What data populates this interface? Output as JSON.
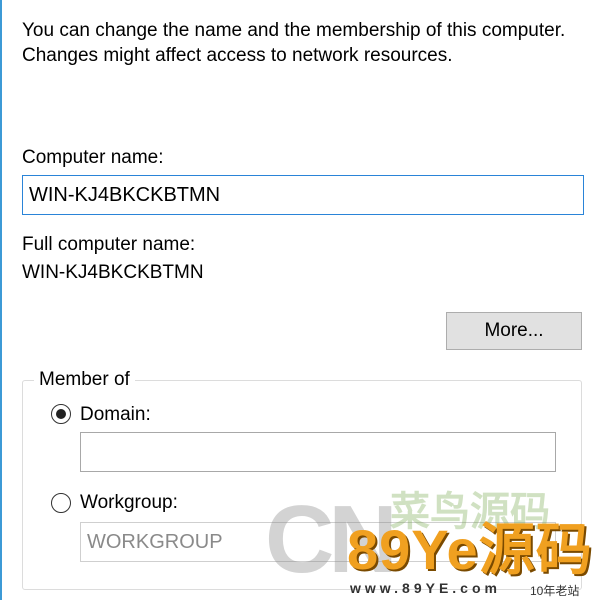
{
  "dialog": {
    "description": "You can change the name and the membership of this computer. Changes might affect access to network resources.",
    "computer_name_label": "Computer name:",
    "computer_name_value": "WIN-KJ4BKCKBTMN",
    "full_name_label": "Full computer name:",
    "full_name_value": "WIN-KJ4BKCKBTMN",
    "more_button": "More...",
    "member_of": {
      "legend": "Member of",
      "domain_label": "Domain:",
      "domain_value": "",
      "domain_selected": true,
      "workgroup_label": "Workgroup:",
      "workgroup_value": "WORKGROUP",
      "workgroup_selected": false
    }
  },
  "watermark": {
    "big_letters": "CN",
    "chinese_top": "菜鸟源码",
    "brand": "89Ye源码",
    "url": "www.89YE.com",
    "tag": "10年老站"
  },
  "colors": {
    "accent": "#2a84d8",
    "window_border": "#3c9ad6",
    "button_face": "#e1e1e1",
    "watermark_brand": "#f0a020"
  }
}
